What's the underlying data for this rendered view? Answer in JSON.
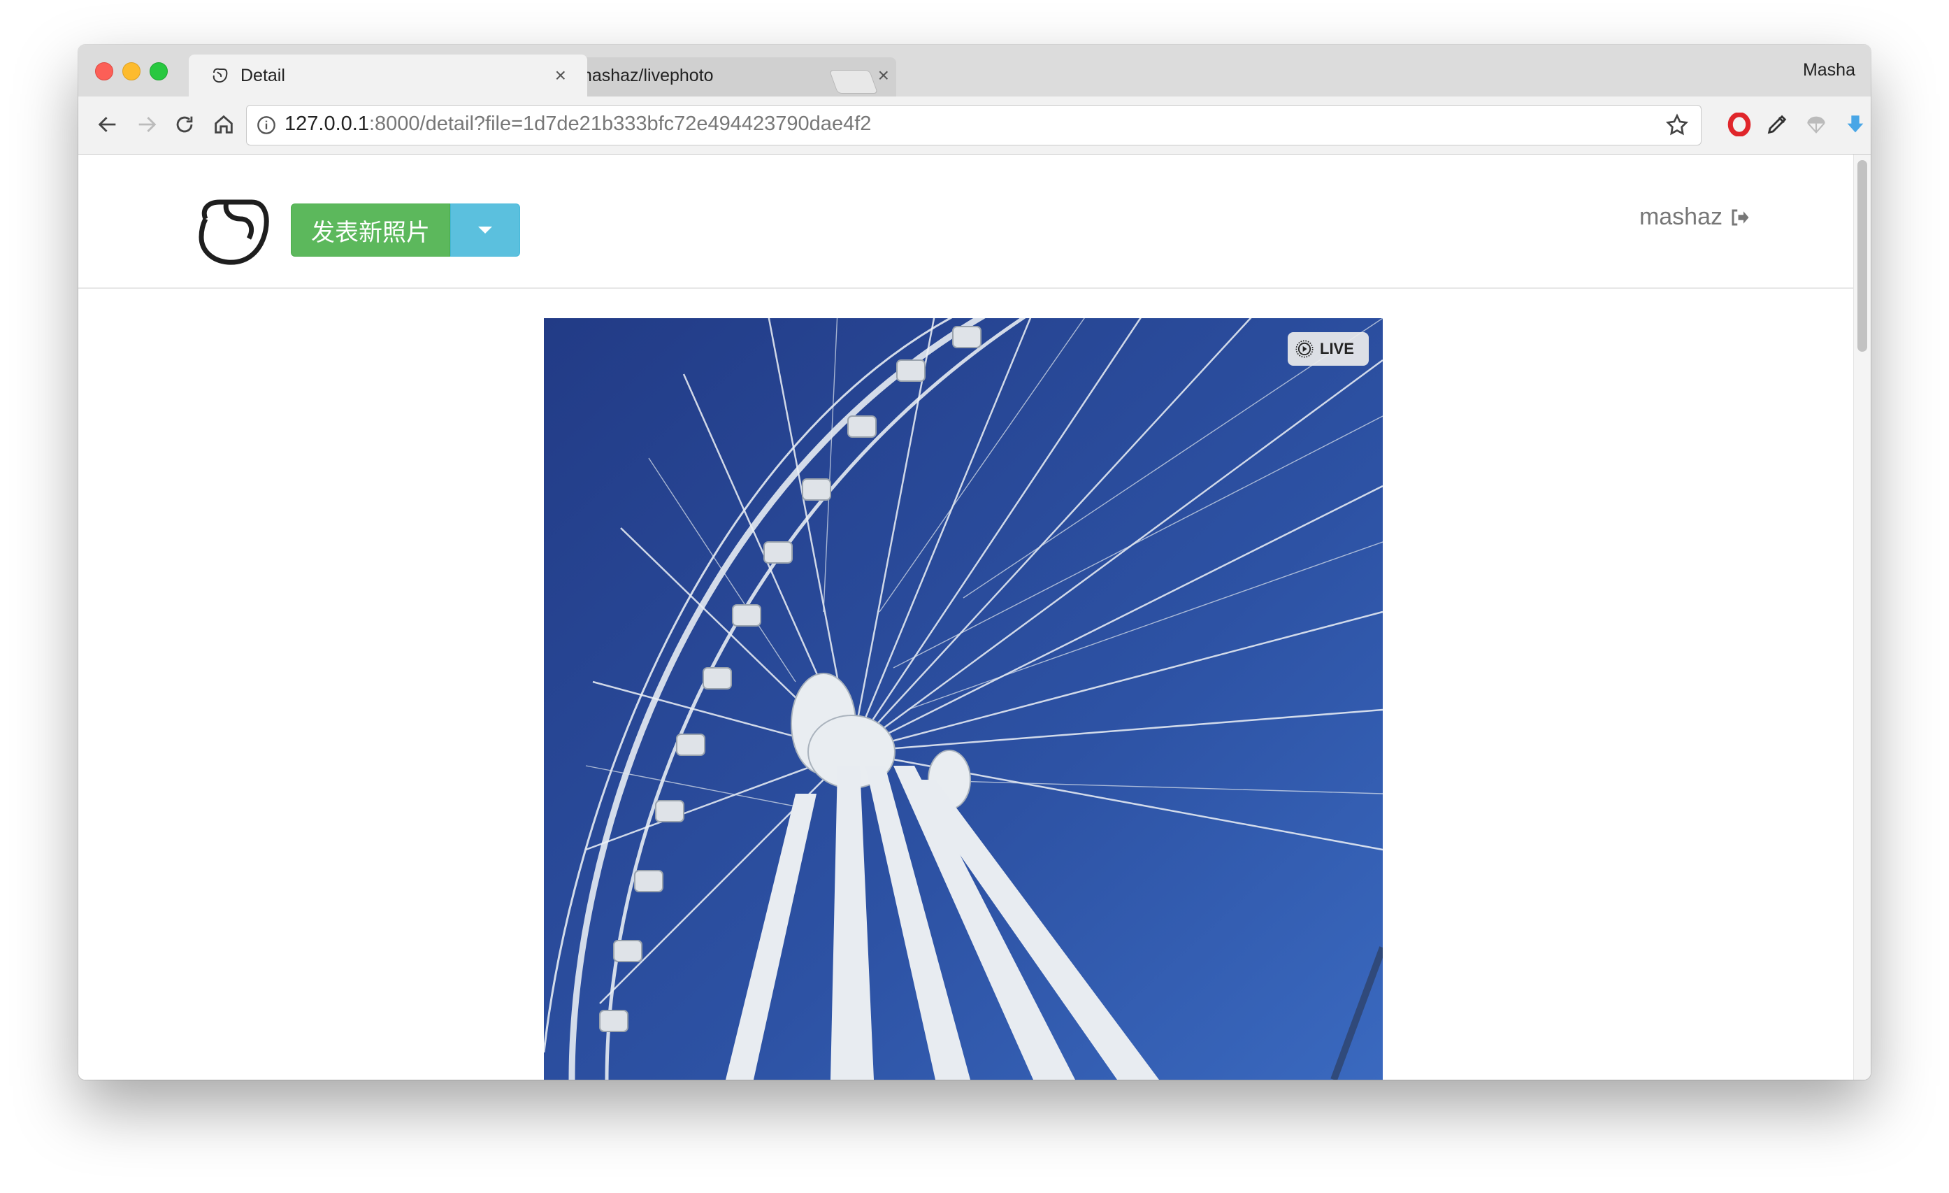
{
  "browser": {
    "tabs": [
      {
        "title": "Detail",
        "active": true,
        "favicon": "livephoto-icon"
      },
      {
        "title": "mashaz/livephoto",
        "active": false,
        "favicon": "github-icon"
      }
    ],
    "close_glyph": "×",
    "profile_name": "Masha",
    "url_host": "127.0.0.1",
    "url_rest": ":8000/detail?file=1d7de21b333bfc72e494423790dae4f2",
    "extensions": [
      "opera-icon",
      "pen-icon",
      "parachute-icon",
      "download-icon",
      "camera-lens-icon"
    ]
  },
  "app": {
    "publish_button": "发表新照片",
    "username": "mashaz",
    "photo": {
      "badge": "LIVE",
      "subject": "ferris-wheel"
    }
  },
  "colors": {
    "publish": "#5cb85c",
    "dropdown": "#5bc0de",
    "sky": "#2e55a6"
  }
}
